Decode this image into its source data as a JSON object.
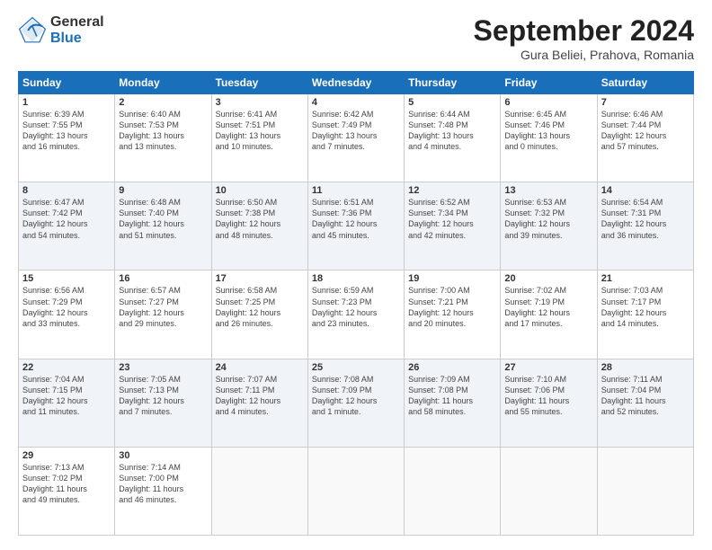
{
  "header": {
    "logo_general": "General",
    "logo_blue": "Blue",
    "month_title": "September 2024",
    "location": "Gura Beliei, Prahova, Romania"
  },
  "days_of_week": [
    "Sunday",
    "Monday",
    "Tuesday",
    "Wednesday",
    "Thursday",
    "Friday",
    "Saturday"
  ],
  "weeks": [
    [
      {
        "day": "1",
        "info": "Sunrise: 6:39 AM\nSunset: 7:55 PM\nDaylight: 13 hours\nand 16 minutes."
      },
      {
        "day": "2",
        "info": "Sunrise: 6:40 AM\nSunset: 7:53 PM\nDaylight: 13 hours\nand 13 minutes."
      },
      {
        "day": "3",
        "info": "Sunrise: 6:41 AM\nSunset: 7:51 PM\nDaylight: 13 hours\nand 10 minutes."
      },
      {
        "day": "4",
        "info": "Sunrise: 6:42 AM\nSunset: 7:49 PM\nDaylight: 13 hours\nand 7 minutes."
      },
      {
        "day": "5",
        "info": "Sunrise: 6:44 AM\nSunset: 7:48 PM\nDaylight: 13 hours\nand 4 minutes."
      },
      {
        "day": "6",
        "info": "Sunrise: 6:45 AM\nSunset: 7:46 PM\nDaylight: 13 hours\nand 0 minutes."
      },
      {
        "day": "7",
        "info": "Sunrise: 6:46 AM\nSunset: 7:44 PM\nDaylight: 12 hours\nand 57 minutes."
      }
    ],
    [
      {
        "day": "8",
        "info": "Sunrise: 6:47 AM\nSunset: 7:42 PM\nDaylight: 12 hours\nand 54 minutes."
      },
      {
        "day": "9",
        "info": "Sunrise: 6:48 AM\nSunset: 7:40 PM\nDaylight: 12 hours\nand 51 minutes."
      },
      {
        "day": "10",
        "info": "Sunrise: 6:50 AM\nSunset: 7:38 PM\nDaylight: 12 hours\nand 48 minutes."
      },
      {
        "day": "11",
        "info": "Sunrise: 6:51 AM\nSunset: 7:36 PM\nDaylight: 12 hours\nand 45 minutes."
      },
      {
        "day": "12",
        "info": "Sunrise: 6:52 AM\nSunset: 7:34 PM\nDaylight: 12 hours\nand 42 minutes."
      },
      {
        "day": "13",
        "info": "Sunrise: 6:53 AM\nSunset: 7:32 PM\nDaylight: 12 hours\nand 39 minutes."
      },
      {
        "day": "14",
        "info": "Sunrise: 6:54 AM\nSunset: 7:31 PM\nDaylight: 12 hours\nand 36 minutes."
      }
    ],
    [
      {
        "day": "15",
        "info": "Sunrise: 6:56 AM\nSunset: 7:29 PM\nDaylight: 12 hours\nand 33 minutes."
      },
      {
        "day": "16",
        "info": "Sunrise: 6:57 AM\nSunset: 7:27 PM\nDaylight: 12 hours\nand 29 minutes."
      },
      {
        "day": "17",
        "info": "Sunrise: 6:58 AM\nSunset: 7:25 PM\nDaylight: 12 hours\nand 26 minutes."
      },
      {
        "day": "18",
        "info": "Sunrise: 6:59 AM\nSunset: 7:23 PM\nDaylight: 12 hours\nand 23 minutes."
      },
      {
        "day": "19",
        "info": "Sunrise: 7:00 AM\nSunset: 7:21 PM\nDaylight: 12 hours\nand 20 minutes."
      },
      {
        "day": "20",
        "info": "Sunrise: 7:02 AM\nSunset: 7:19 PM\nDaylight: 12 hours\nand 17 minutes."
      },
      {
        "day": "21",
        "info": "Sunrise: 7:03 AM\nSunset: 7:17 PM\nDaylight: 12 hours\nand 14 minutes."
      }
    ],
    [
      {
        "day": "22",
        "info": "Sunrise: 7:04 AM\nSunset: 7:15 PM\nDaylight: 12 hours\nand 11 minutes."
      },
      {
        "day": "23",
        "info": "Sunrise: 7:05 AM\nSunset: 7:13 PM\nDaylight: 12 hours\nand 7 minutes."
      },
      {
        "day": "24",
        "info": "Sunrise: 7:07 AM\nSunset: 7:11 PM\nDaylight: 12 hours\nand 4 minutes."
      },
      {
        "day": "25",
        "info": "Sunrise: 7:08 AM\nSunset: 7:09 PM\nDaylight: 12 hours\nand 1 minute."
      },
      {
        "day": "26",
        "info": "Sunrise: 7:09 AM\nSunset: 7:08 PM\nDaylight: 11 hours\nand 58 minutes."
      },
      {
        "day": "27",
        "info": "Sunrise: 7:10 AM\nSunset: 7:06 PM\nDaylight: 11 hours\nand 55 minutes."
      },
      {
        "day": "28",
        "info": "Sunrise: 7:11 AM\nSunset: 7:04 PM\nDaylight: 11 hours\nand 52 minutes."
      }
    ],
    [
      {
        "day": "29",
        "info": "Sunrise: 7:13 AM\nSunset: 7:02 PM\nDaylight: 11 hours\nand 49 minutes."
      },
      {
        "day": "30",
        "info": "Sunrise: 7:14 AM\nSunset: 7:00 PM\nDaylight: 11 hours\nand 46 minutes."
      },
      {
        "day": "",
        "info": ""
      },
      {
        "day": "",
        "info": ""
      },
      {
        "day": "",
        "info": ""
      },
      {
        "day": "",
        "info": ""
      },
      {
        "day": "",
        "info": ""
      }
    ]
  ]
}
